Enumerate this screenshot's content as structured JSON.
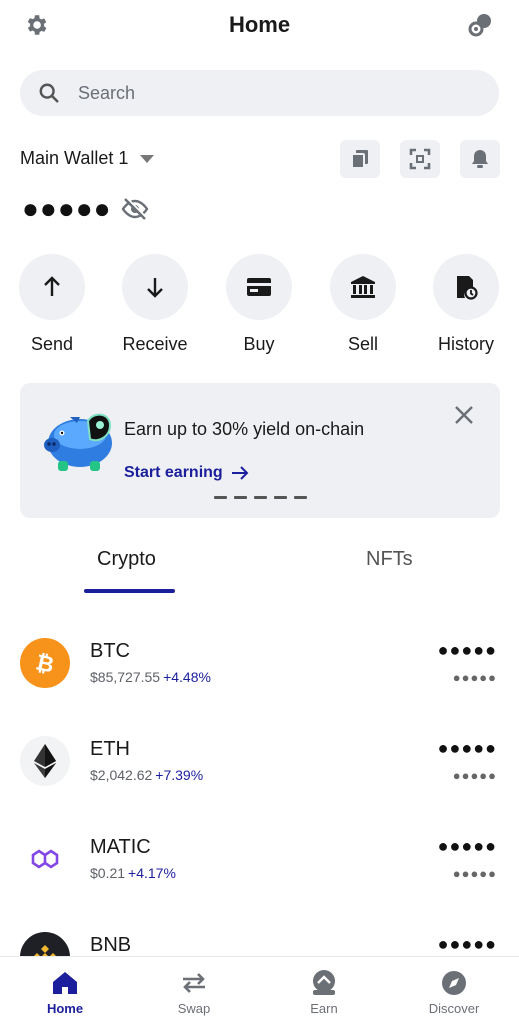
{
  "header": {
    "title": "Home",
    "settings_icon": "gear-icon",
    "connect_icon": "link-icon"
  },
  "search": {
    "placeholder": "Search",
    "value": ""
  },
  "wallet": {
    "name": "Main Wallet 1",
    "balance": "●●●●●"
  },
  "wallet_actions": [
    "copy-icon",
    "scan-icon",
    "bell-icon"
  ],
  "actions": [
    {
      "label": "Send",
      "icon": "arrow-up-icon"
    },
    {
      "label": "Receive",
      "icon": "arrow-down-icon"
    },
    {
      "label": "Buy",
      "icon": "card-icon"
    },
    {
      "label": "Sell",
      "icon": "bank-icon"
    },
    {
      "label": "History",
      "icon": "history-icon"
    }
  ],
  "promo": {
    "title": "Earn up to 30% yield on-chain",
    "link": "Start earning"
  },
  "tabs": [
    {
      "label": "Crypto",
      "active": true
    },
    {
      "label": "NFTs",
      "active": false
    }
  ],
  "assets": [
    {
      "symbol": "BTC",
      "price": "$85,727.55",
      "change": "+4.48%",
      "balance": "●●●●●",
      "value": "●●●●●",
      "color": "#f7931a"
    },
    {
      "symbol": "ETH",
      "price": "$2,042.62",
      "change": "+7.39%",
      "balance": "●●●●●",
      "value": "●●●●●",
      "color": "#f2f3f5"
    },
    {
      "symbol": "MATIC",
      "price": "$0.21",
      "change": "+4.17%",
      "balance": "●●●●●",
      "value": "●●●●●",
      "color": "#8247e5"
    },
    {
      "symbol": "BNB",
      "price": "",
      "change": "",
      "balance": "●●●●●",
      "value": "",
      "color": "#f3ba2f"
    }
  ],
  "bottom_nav": [
    {
      "label": "Home",
      "active": true
    },
    {
      "label": "Swap",
      "active": false
    },
    {
      "label": "Earn",
      "active": false
    },
    {
      "label": "Discover",
      "active": false
    }
  ],
  "colors": {
    "accent": "#1c1f9c",
    "surface": "#eef0f3",
    "text": "#1a1a1a"
  }
}
